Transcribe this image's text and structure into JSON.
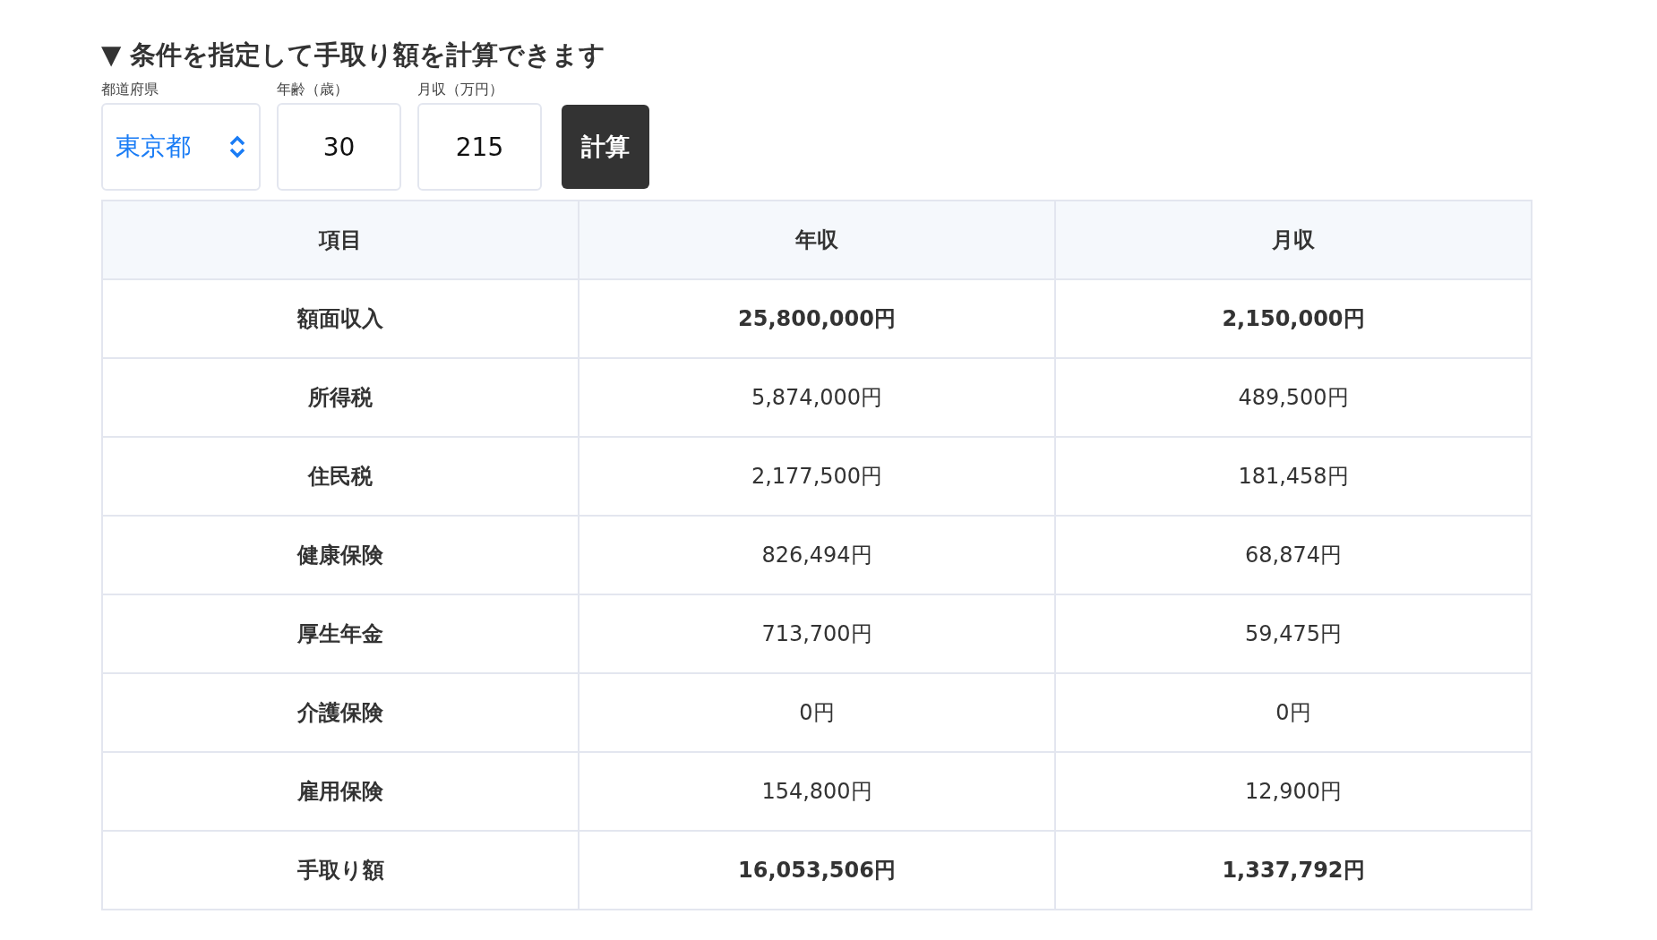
{
  "heading": "▼ 条件を指定して手取り額を計算できます",
  "form": {
    "prefecture": {
      "label": "都道府県",
      "value": "東京都"
    },
    "age": {
      "label": "年齢（歳）",
      "value": "30"
    },
    "income": {
      "label": "月収（万円）",
      "value": "215"
    },
    "button": "計算"
  },
  "table": {
    "columns": [
      "項目",
      "年収",
      "月収"
    ],
    "rows": [
      {
        "item": "額面収入",
        "annual": "25,800,000円",
        "monthly": "2,150,000円",
        "bold": true
      },
      {
        "item": "所得税",
        "annual": "5,874,000円",
        "monthly": "489,500円",
        "bold": false
      },
      {
        "item": "住民税",
        "annual": "2,177,500円",
        "monthly": "181,458円",
        "bold": false
      },
      {
        "item": "健康保険",
        "annual": "826,494円",
        "monthly": "68,874円",
        "bold": false
      },
      {
        "item": "厚生年金",
        "annual": "713,700円",
        "monthly": "59,475円",
        "bold": false
      },
      {
        "item": "介護保険",
        "annual": "0円",
        "monthly": "0円",
        "bold": false
      },
      {
        "item": "雇用保険",
        "annual": "154,800円",
        "monthly": "12,900円",
        "bold": false
      },
      {
        "item": "手取り額",
        "annual": "16,053,506円",
        "monthly": "1,337,792円",
        "bold": true
      }
    ]
  }
}
